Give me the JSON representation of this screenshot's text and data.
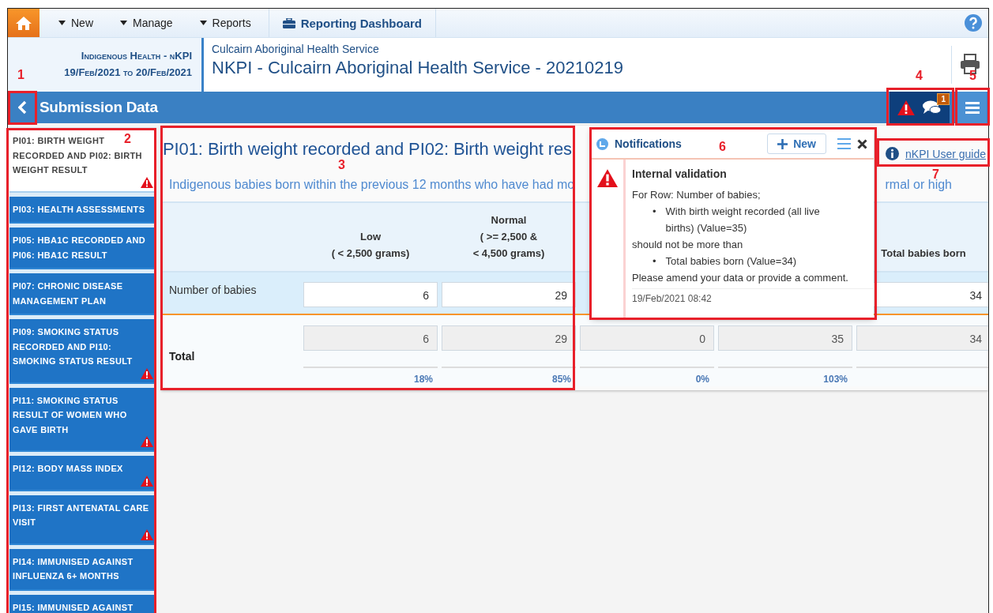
{
  "nav": {
    "items": [
      {
        "label": "New",
        "kind": "dropdown"
      },
      {
        "label": "Manage",
        "kind": "dropdown"
      },
      {
        "label": "Reports",
        "kind": "dropdown"
      },
      {
        "label": "Reporting Dashboard",
        "kind": "dashboard"
      }
    ]
  },
  "header": {
    "program": "Indigenous Health - nKPI",
    "period": "19/Feb/2021 to 20/Feb/2021",
    "organisation": "Culcairn Aboriginal Health Service",
    "title": "NKPI - Culcairn Aboriginal Health Service - 20210219"
  },
  "section_bar": {
    "title": "Submission Data",
    "comment_count": "1"
  },
  "sidebar": {
    "items": [
      {
        "label": "PI01: BIRTH WEIGHT RECORDED AND PI02: BIRTH WEIGHT RESULT",
        "selected": true,
        "warning": true
      },
      {
        "label": "PI03: HEALTH ASSESSMENTS",
        "selected": false,
        "warning": false
      },
      {
        "label": "PI05: HBA1C RECORDED AND PI06: HBA1C RESULT",
        "selected": false,
        "warning": false
      },
      {
        "label": "PI07: CHRONIC DISEASE MANAGEMENT PLAN",
        "selected": false,
        "warning": false
      },
      {
        "label": "PI09: SMOKING STATUS RECORDED AND PI10: SMOKING STATUS RESULT",
        "selected": false,
        "warning": true
      },
      {
        "label": "PI11: SMOKING STATUS RESULT OF WOMEN WHO GAVE BIRTH",
        "selected": false,
        "warning": true
      },
      {
        "label": "PI12: BODY MASS INDEX",
        "selected": false,
        "warning": true
      },
      {
        "label": "PI13: FIRST ANTENATAL CARE VISIT",
        "selected": false,
        "warning": true
      },
      {
        "label": "PI14: IMMUNISED AGAINST INFLUENZA 6+ MONTHS",
        "selected": false,
        "warning": false
      },
      {
        "label": "PI15: IMMUNISED AGAINST",
        "selected": false,
        "warning": false
      }
    ]
  },
  "form": {
    "title": "PI01: Birth weight recorded and PI02: Birth weight res",
    "guide_link": "nKPI User guide",
    "description_start": "Indigenous babies born within the previous 12 months who have had mo",
    "description_end": "rmal or high",
    "columns": [
      {
        "lines": [
          "Low",
          "( < 2,500 grams)"
        ]
      },
      {
        "lines": [
          "Normal",
          "( >= 2,500 &",
          "< 4,500 grams)"
        ]
      },
      {},
      {},
      {
        "lines": [
          "Total babies born"
        ]
      }
    ],
    "rows": [
      {
        "kind": "input",
        "label": "Number of babies",
        "cells": [
          {
            "value": "6"
          },
          {
            "value": "29"
          },
          {},
          {},
          {
            "value": "34"
          }
        ]
      },
      {
        "kind": "total",
        "label": "Total",
        "cells": [
          {
            "value": "6",
            "percentage": "18%"
          },
          {
            "value": "29",
            "percentage": "85%"
          },
          {
            "value": "0",
            "percentage": "0%"
          },
          {
            "value": "35",
            "percentage": "103%"
          },
          {
            "value": "34"
          }
        ]
      }
    ]
  },
  "notifications": {
    "title": "Notifications",
    "new_button": "New",
    "items": [
      {
        "kind": "warning",
        "heading": "Internal validation",
        "lines": [
          {
            "kind": "text",
            "text": "For Row: Number of babies;"
          },
          {
            "kind": "bullet",
            "marker": "•",
            "text": "With birth weight recorded (all live births) (Value=35)"
          },
          {
            "kind": "text",
            "text": "should not be more than"
          },
          {
            "kind": "bullet",
            "marker": "•",
            "text": "Total babies born (Value=34)"
          },
          {
            "kind": "text",
            "text": "Please amend your data or provide a comment."
          }
        ],
        "timestamp": "19/Feb/2021 08:42"
      }
    ]
  },
  "annotations": [
    {
      "number": "1"
    },
    {
      "number": "2"
    },
    {
      "number": "3"
    },
    {
      "number": "4"
    },
    {
      "number": "5"
    },
    {
      "number": "6"
    },
    {
      "number": "7"
    }
  ]
}
